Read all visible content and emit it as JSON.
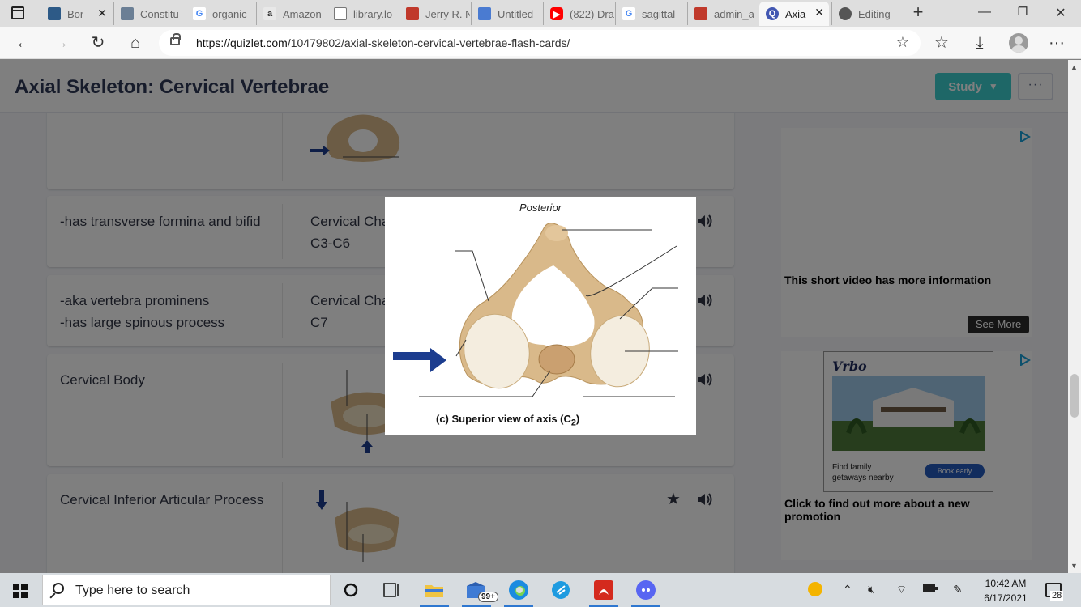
{
  "browser": {
    "tabs": [
      {
        "title": "Bor",
        "favicon_color": "#2d5a87",
        "closable": true
      },
      {
        "title": "Constitu",
        "favicon_color": "#6b7f95"
      },
      {
        "title": "organic",
        "favicon_color": "#4285f4",
        "favicon_text": "G"
      },
      {
        "title": "Amazon",
        "favicon_color": "#666666",
        "favicon_text": "a"
      },
      {
        "title": "library.lo",
        "favicon_color": "#888888"
      },
      {
        "title": "Jerry R. N",
        "favicon_color": "#c0392b"
      },
      {
        "title": "Untitled",
        "favicon_color": "#4a7bd1"
      },
      {
        "title": "(822) Dra",
        "favicon_color": "#ff0000"
      },
      {
        "title": "sagittal",
        "favicon_color": "#4285f4",
        "favicon_text": "G"
      },
      {
        "title": "admin_a",
        "favicon_color": "#c0392b"
      },
      {
        "title": "Axia",
        "favicon_color": "#4257b2",
        "favicon_text": "Q",
        "active": true
      },
      {
        "title": "Editing",
        "favicon_color": "#555555"
      }
    ],
    "url_host": "https://quizlet.com",
    "url_path": "/10479802/axial-skeleton-cervical-vertebrae-flash-cards/"
  },
  "page": {
    "title": "Axial Skeleton: Cervical Vertebrae",
    "study_label": "Study",
    "more_label": "···",
    "cards": [
      {
        "term": "-has transverse formina and bifid",
        "definition": "Cervical Cha\nC3-C6"
      },
      {
        "term": "-aka vertebra prominens\n-has large spinous process",
        "definition": "Cervical Cha\nC7"
      },
      {
        "term": "Cervical Body",
        "definition": ""
      },
      {
        "term": "Cervical Inferior Articular Process",
        "definition": ""
      }
    ],
    "thumb_caption": "(c) Superior view of axis (C2)"
  },
  "ads": {
    "video_ad_text": "This short video has more information",
    "see_more_label": "See More",
    "vrbo_logo": "Vrbo",
    "vrbo_copy": "Find family\ngetaways nearby",
    "vrbo_button": "Book early",
    "promo_text": "Click to find out more about a new promotion"
  },
  "modal": {
    "top_label": "Posterior",
    "caption": "(c) Superior view of axis (C",
    "caption_sub": "2",
    "caption_end": ")"
  },
  "taskbar": {
    "search_placeholder": "Type here to search",
    "mail_badge": "99+",
    "time": "10:42 AM",
    "date": "6/17/2021",
    "notification_count": "28"
  },
  "colors": {
    "study_button": "#3ccfcf",
    "title_text": "#2e3856",
    "arrow_blue": "#1c3d8f",
    "bone": "#d9b98a"
  }
}
